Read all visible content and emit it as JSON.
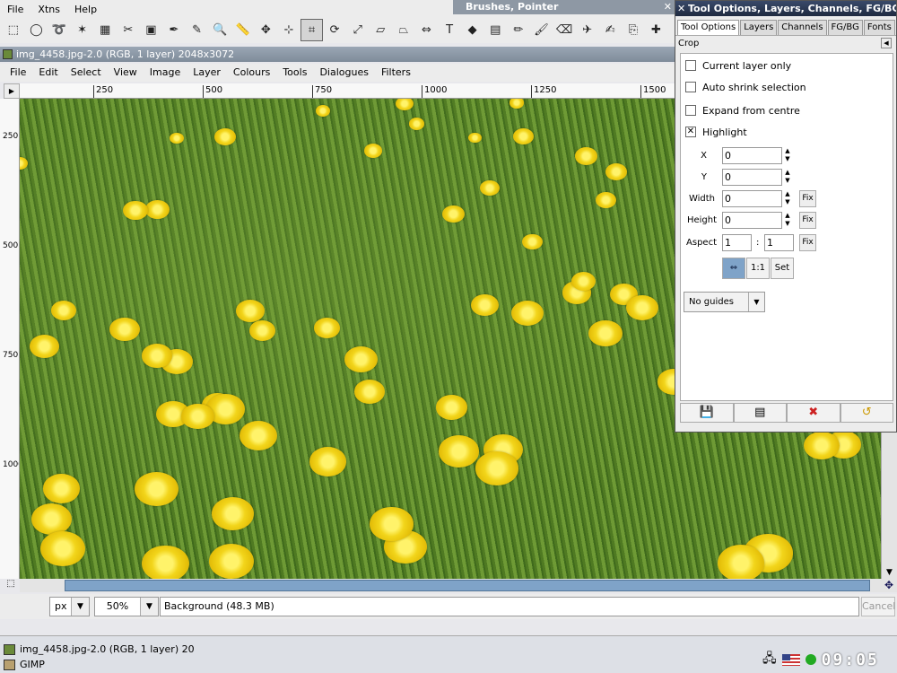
{
  "toolbox": {
    "menu": [
      "File",
      "Xtns",
      "Help"
    ],
    "tools": [
      {
        "name": "rect-select-icon",
        "glyph": "⬚"
      },
      {
        "name": "ellipse-select-icon",
        "glyph": "◯"
      },
      {
        "name": "free-select-icon",
        "glyph": "➰"
      },
      {
        "name": "fuzzy-select-icon",
        "glyph": "✶"
      },
      {
        "name": "color-select-icon",
        "glyph": "▦"
      },
      {
        "name": "scissors-select-icon",
        "glyph": "✂"
      },
      {
        "name": "foreground-select-icon",
        "glyph": "▣"
      },
      {
        "name": "paths-icon",
        "glyph": "✒"
      },
      {
        "name": "color-picker-icon",
        "glyph": "✎"
      },
      {
        "name": "zoom-icon",
        "glyph": "🔍"
      },
      {
        "name": "measure-icon",
        "glyph": "📏"
      },
      {
        "name": "move-icon",
        "glyph": "✥"
      },
      {
        "name": "align-icon",
        "glyph": "⊹"
      },
      {
        "name": "crop-icon",
        "glyph": "⌗"
      },
      {
        "name": "rotate-icon",
        "glyph": "⟳"
      },
      {
        "name": "scale-icon",
        "glyph": "⤢"
      },
      {
        "name": "shear-icon",
        "glyph": "▱"
      },
      {
        "name": "perspective-icon",
        "glyph": "⏢"
      },
      {
        "name": "flip-icon",
        "glyph": "⇔"
      },
      {
        "name": "text-icon",
        "glyph": "T"
      },
      {
        "name": "bucket-fill-icon",
        "glyph": "◆"
      },
      {
        "name": "blend-icon",
        "glyph": "▤"
      },
      {
        "name": "pencil-icon",
        "glyph": "✏"
      },
      {
        "name": "paintbrush-icon",
        "glyph": "🖌"
      },
      {
        "name": "eraser-icon",
        "glyph": "⌫"
      },
      {
        "name": "airbrush-icon",
        "glyph": "✈"
      },
      {
        "name": "ink-icon",
        "glyph": "✍"
      },
      {
        "name": "clone-icon",
        "glyph": "⎘"
      },
      {
        "name": "heal-icon",
        "glyph": "✚"
      },
      {
        "name": "smudge-icon",
        "glyph": "☞"
      },
      {
        "name": "dodge-burn-icon",
        "glyph": "◐"
      }
    ],
    "active_tool": "crop-icon"
  },
  "brushes_dock": {
    "title": "Brushes, Pointer",
    "close": "✕"
  },
  "image_window": {
    "title": "img_4458.jpg-2.0 (RGB, 1 layer) 2048x3072",
    "menu": [
      "File",
      "Edit",
      "Select",
      "View",
      "Image",
      "Layer",
      "Colours",
      "Tools",
      "Dialogues",
      "Filters"
    ],
    "hruler_ticks": [
      "250",
      "500",
      "750",
      "1000",
      "1250",
      "1500"
    ],
    "vruler_ticks": [
      "250",
      "500",
      "750",
      "1000"
    ],
    "unit": "px",
    "zoom": "50%",
    "status": "Background (48.3 MB)",
    "cancel": "Cancel"
  },
  "dock": {
    "title": "Tool Options, Layers, Channels, FG/BG",
    "close": "✕",
    "tabs": [
      "Tool Options",
      "Layers",
      "Channels",
      "FG/BG",
      "Fonts"
    ],
    "tool_name": "Crop",
    "checkboxes": [
      {
        "label": "Current layer only",
        "checked": false
      },
      {
        "label": "Auto shrink selection",
        "checked": false
      },
      {
        "label": "Expand from centre",
        "checked": false
      },
      {
        "label": "Highlight",
        "checked": true
      }
    ],
    "fields": {
      "x_label": "X",
      "x": "0",
      "y_label": "Y",
      "y": "0",
      "width_label": "Width",
      "width": "0",
      "height_label": "Height",
      "height": "0",
      "aspect_label": "Aspect",
      "aspect_a": "1",
      "aspect_sep": ":",
      "aspect_b": "1",
      "fix": "Fix"
    },
    "ratio_buttons": {
      "one_to_one": "1:1",
      "set": "Set"
    },
    "guides": "No guides",
    "actions": [
      "save-icon",
      "restore-icon",
      "delete-icon",
      "reset-icon"
    ]
  },
  "taskbar": {
    "task1": "img_4458.jpg-2.0 (RGB, 1 layer) 20",
    "task2": "GIMP",
    "clock": "09:05"
  }
}
